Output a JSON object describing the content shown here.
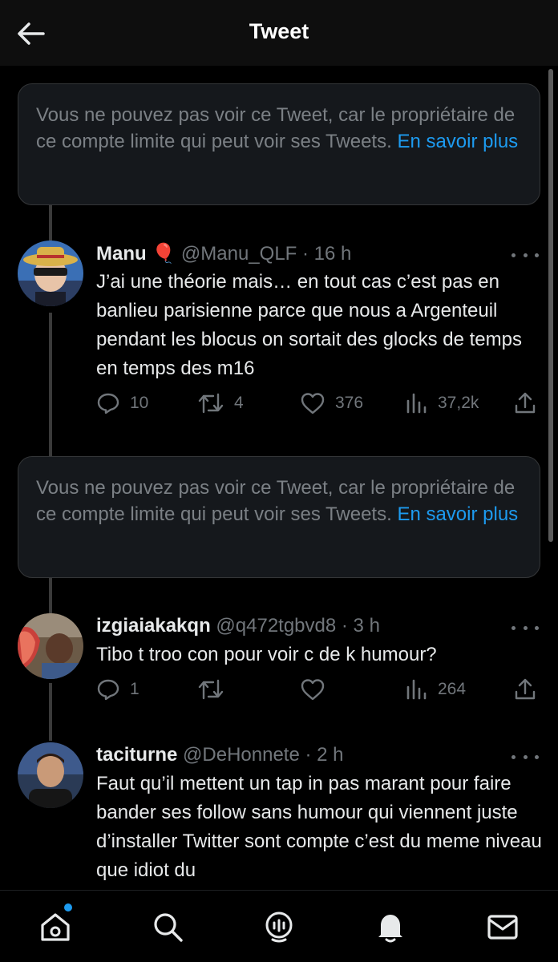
{
  "header": {
    "title": "Tweet"
  },
  "unavailable_notices": [
    {
      "text": "Vous ne pouvez pas voir ce Tweet, car le propriétaire de ce compte limite qui peut voir ses Tweets.",
      "link": "En savoir plus"
    },
    {
      "text": "Vous ne pouvez pas voir ce Tweet, car le propriétaire de ce compte limite qui peut voir ses Tweets.",
      "link": "En savoir plus"
    }
  ],
  "tweets": [
    {
      "name": "Manu",
      "emoji": "🎈",
      "handle": "@Manu_QLF",
      "time": "· 16 h",
      "text": "J’ai une théorie mais… en tout cas c’est pas en banlieu parisienne parce que nous a Argenteuil pendant les blocus on sortait des glocks de temps en temps des m16",
      "replies": "10",
      "retweets": "4",
      "likes": "376",
      "views": "37,2k"
    },
    {
      "name": "izgiaiakakqn",
      "handle": "@q472tgbvd8",
      "time": "· 3 h",
      "text": "Tibo t troo con pour voir c de k humour?",
      "replies": "1",
      "retweets": "",
      "likes": "",
      "views": "264"
    },
    {
      "name": "taciturne",
      "handle": "@DeHonnete",
      "time": "· 2 h",
      "text": "Faut qu’il mettent un tap in pas marant pour faire bander ses follow sans humour qui viennent juste d’installer Twitter sont compte c’est du meme niveau que idiot du"
    }
  ],
  "colors": {
    "accent": "#1d9bf0",
    "muted": "#71767b",
    "background": "#000000"
  },
  "bottom_nav": [
    "home-icon",
    "search-icon",
    "spaces-icon",
    "bell-icon",
    "mail-icon"
  ]
}
